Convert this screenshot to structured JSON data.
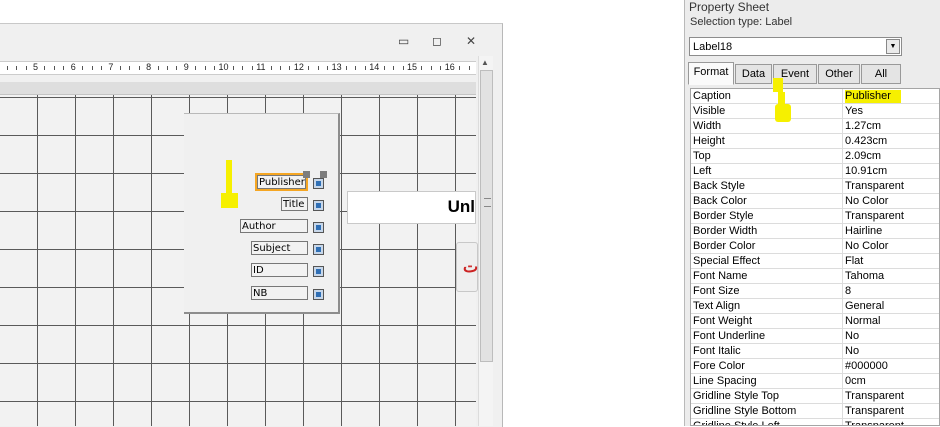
{
  "design": {
    "window_controls": {
      "minimize": "▭",
      "maximize": "◻",
      "close": "✕"
    },
    "ruler_numbers": [
      "5",
      "6",
      "7",
      "8",
      "9",
      "10",
      "11",
      "12",
      "13",
      "14",
      "15",
      "16"
    ],
    "labels": {
      "publisher": "Publisher",
      "title": "Title",
      "author": "Author",
      "subject": "Subject",
      "id": "ID",
      "nb": "NB"
    },
    "big_label": "Unl",
    "red_button": "ت"
  },
  "property_sheet": {
    "title": "Property Sheet",
    "selection_type": "Selection type:  Label",
    "selected_object": "Label18",
    "tabs": [
      "Format",
      "Data",
      "Event",
      "Other",
      "All"
    ],
    "active_tab": "Format",
    "properties": [
      {
        "name": "Caption",
        "value": "Publisher"
      },
      {
        "name": "Visible",
        "value": "Yes"
      },
      {
        "name": "Width",
        "value": "1.27cm"
      },
      {
        "name": "Height",
        "value": "0.423cm"
      },
      {
        "name": "Top",
        "value": "2.09cm"
      },
      {
        "name": "Left",
        "value": "10.91cm"
      },
      {
        "name": "Back Style",
        "value": "Transparent"
      },
      {
        "name": "Back Color",
        "value": "No Color"
      },
      {
        "name": "Border Style",
        "value": "Transparent"
      },
      {
        "name": "Border Width",
        "value": "Hairline"
      },
      {
        "name": "Border Color",
        "value": "No Color"
      },
      {
        "name": "Special Effect",
        "value": "Flat"
      },
      {
        "name": "Font Name",
        "value": "Tahoma"
      },
      {
        "name": "Font Size",
        "value": "8"
      },
      {
        "name": "Text Align",
        "value": "General"
      },
      {
        "name": "Font Weight",
        "value": "Normal"
      },
      {
        "name": "Font Underline",
        "value": "No"
      },
      {
        "name": "Font Italic",
        "value": "No"
      },
      {
        "name": "Fore Color",
        "value": "#000000"
      },
      {
        "name": "Line Spacing",
        "value": "0cm"
      },
      {
        "name": "Gridline Style Top",
        "value": "Transparent"
      },
      {
        "name": "Gridline Style Bottom",
        "value": "Transparent"
      },
      {
        "name": "Gridline Style Left",
        "value": "Transparent"
      }
    ]
  },
  "colors": {
    "highlight": "#f6f000",
    "selection": "#f5a623",
    "grid": "#5a5a5a"
  }
}
